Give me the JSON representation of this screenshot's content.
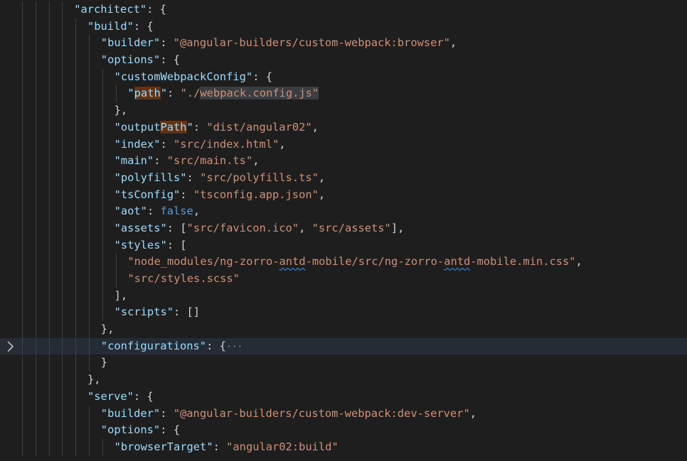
{
  "editor": {
    "language": "json",
    "fold_icon": "chevron-right-icon",
    "lines": [
      {
        "indent": 4,
        "tokens": [
          {
            "t": "key",
            "v": "\"architect\""
          },
          {
            "t": "pun",
            "v": ": {"
          }
        ]
      },
      {
        "indent": 5,
        "tokens": [
          {
            "t": "key",
            "v": "\"build\""
          },
          {
            "t": "pun",
            "v": ": {"
          }
        ]
      },
      {
        "indent": 6,
        "tokens": [
          {
            "t": "key",
            "v": "\"builder\""
          },
          {
            "t": "pun",
            "v": ": "
          },
          {
            "t": "str",
            "v": "\"@angular-builders/custom-webpack:browser\""
          },
          {
            "t": "pun",
            "v": ","
          }
        ]
      },
      {
        "indent": 6,
        "tokens": [
          {
            "t": "key",
            "v": "\"options\""
          },
          {
            "t": "pun",
            "v": ": {"
          }
        ]
      },
      {
        "indent": 7,
        "tokens": [
          {
            "t": "key",
            "v": "\"customWebpackConfig\""
          },
          {
            "t": "pun",
            "v": ": {"
          }
        ]
      },
      {
        "indent": 8,
        "tokens": [
          {
            "t": "key",
            "v": "\""
          },
          {
            "t": "key",
            "v": "path",
            "hl": "word"
          },
          {
            "t": "key",
            "v": "\""
          },
          {
            "t": "pun",
            "v": ": "
          },
          {
            "t": "str",
            "v": "\"./"
          },
          {
            "t": "str",
            "v": "webpack.config.js\"",
            "hl": "sel"
          }
        ]
      },
      {
        "indent": 7,
        "tokens": [
          {
            "t": "pun",
            "v": "},"
          }
        ]
      },
      {
        "indent": 7,
        "tokens": [
          {
            "t": "key",
            "v": "\"output"
          },
          {
            "t": "key",
            "v": "Path",
            "hl": "word"
          },
          {
            "t": "key",
            "v": "\""
          },
          {
            "t": "pun",
            "v": ": "
          },
          {
            "t": "str",
            "v": "\"dist/angular02\""
          },
          {
            "t": "pun",
            "v": ","
          }
        ]
      },
      {
        "indent": 7,
        "tokens": [
          {
            "t": "key",
            "v": "\"index\""
          },
          {
            "t": "pun",
            "v": ": "
          },
          {
            "t": "str",
            "v": "\"src/index.html\""
          },
          {
            "t": "pun",
            "v": ","
          }
        ]
      },
      {
        "indent": 7,
        "tokens": [
          {
            "t": "key",
            "v": "\"main\""
          },
          {
            "t": "pun",
            "v": ": "
          },
          {
            "t": "str",
            "v": "\"src/main.ts\""
          },
          {
            "t": "pun",
            "v": ","
          }
        ]
      },
      {
        "indent": 7,
        "tokens": [
          {
            "t": "key",
            "v": "\"polyfills\""
          },
          {
            "t": "pun",
            "v": ": "
          },
          {
            "t": "str",
            "v": "\"src/polyfills.ts\""
          },
          {
            "t": "pun",
            "v": ","
          }
        ]
      },
      {
        "indent": 7,
        "tokens": [
          {
            "t": "key",
            "v": "\"tsConfig\""
          },
          {
            "t": "pun",
            "v": ": "
          },
          {
            "t": "str",
            "v": "\"tsconfig.app.json\""
          },
          {
            "t": "pun",
            "v": ","
          }
        ]
      },
      {
        "indent": 7,
        "tokens": [
          {
            "t": "key",
            "v": "\"aot\""
          },
          {
            "t": "pun",
            "v": ": "
          },
          {
            "t": "kw",
            "v": "false"
          },
          {
            "t": "pun",
            "v": ","
          }
        ]
      },
      {
        "indent": 7,
        "tokens": [
          {
            "t": "key",
            "v": "\"assets\""
          },
          {
            "t": "pun",
            "v": ": ["
          },
          {
            "t": "str",
            "v": "\"src/favicon.ico\""
          },
          {
            "t": "pun",
            "v": ", "
          },
          {
            "t": "str",
            "v": "\"src/assets\""
          },
          {
            "t": "pun",
            "v": "],"
          }
        ]
      },
      {
        "indent": 7,
        "tokens": [
          {
            "t": "key",
            "v": "\"styles\""
          },
          {
            "t": "pun",
            "v": ": ["
          }
        ]
      },
      {
        "indent": 8,
        "tokens": [
          {
            "t": "str",
            "v": "\"node_modules/ng-zorro-"
          },
          {
            "t": "str",
            "v": "antd",
            "sq": true
          },
          {
            "t": "str",
            "v": "-mobile/src/ng-zorro-"
          },
          {
            "t": "str",
            "v": "antd",
            "sq": true
          },
          {
            "t": "str",
            "v": "-mobile.min.css\""
          },
          {
            "t": "pun",
            "v": ","
          }
        ]
      },
      {
        "indent": 8,
        "tokens": [
          {
            "t": "str",
            "v": "\"src/styles.scss\""
          }
        ]
      },
      {
        "indent": 7,
        "tokens": [
          {
            "t": "pun",
            "v": "],"
          }
        ]
      },
      {
        "indent": 7,
        "tokens": [
          {
            "t": "key",
            "v": "\"scripts\""
          },
          {
            "t": "pun",
            "v": ": []"
          }
        ]
      },
      {
        "indent": 6,
        "tokens": [
          {
            "t": "pun",
            "v": "},"
          }
        ]
      },
      {
        "indent": 6,
        "current": true,
        "folded": true,
        "tokens": [
          {
            "t": "key",
            "v": "\"configurations\""
          },
          {
            "t": "pun",
            "v": ": {"
          },
          {
            "t": "ell",
            "v": "···"
          }
        ]
      },
      {
        "indent": 6,
        "tokens": [
          {
            "t": "pun",
            "v": "}"
          }
        ]
      },
      {
        "indent": 5,
        "tokens": [
          {
            "t": "pun",
            "v": "},"
          }
        ]
      },
      {
        "indent": 5,
        "tokens": [
          {
            "t": "key",
            "v": "\"serve\""
          },
          {
            "t": "pun",
            "v": ": {"
          }
        ]
      },
      {
        "indent": 6,
        "tokens": [
          {
            "t": "key",
            "v": "\"builder\""
          },
          {
            "t": "pun",
            "v": ": "
          },
          {
            "t": "str",
            "v": "\"@angular-builders/custom-webpack:dev-server\""
          },
          {
            "t": "pun",
            "v": ","
          }
        ]
      },
      {
        "indent": 6,
        "tokens": [
          {
            "t": "key",
            "v": "\"options\""
          },
          {
            "t": "pun",
            "v": ": {"
          }
        ]
      },
      {
        "indent": 7,
        "tokens": [
          {
            "t": "key",
            "v": "\"browserTarget\""
          },
          {
            "t": "pun",
            "v": ": "
          },
          {
            "t": "str",
            "v": "\"angular02:build\""
          }
        ]
      }
    ]
  }
}
